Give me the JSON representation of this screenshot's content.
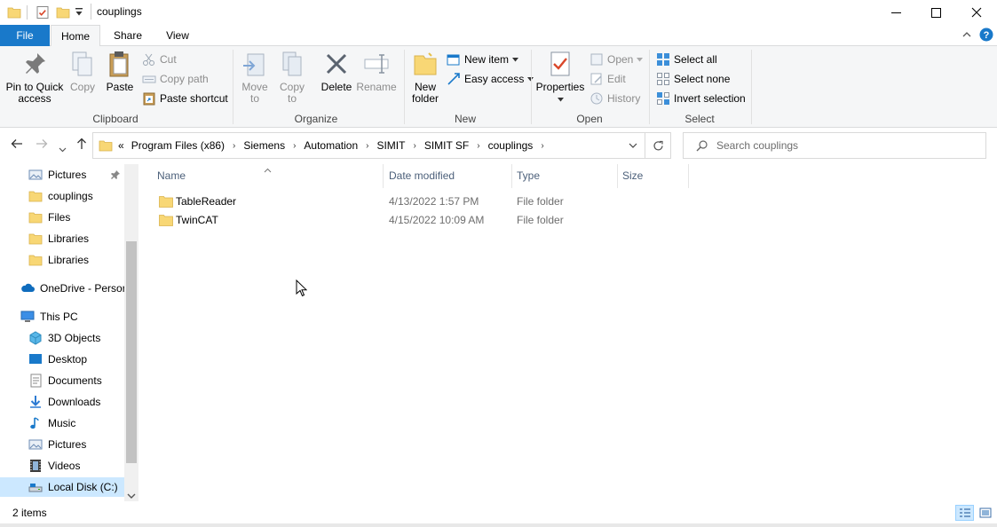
{
  "window": {
    "title": "couplings",
    "controls": {
      "minimize": "—",
      "maximize": "☐",
      "close": "✕"
    }
  },
  "ribbon_tabs": [
    "File",
    "Home",
    "Share",
    "View"
  ],
  "ribbon": {
    "clipboard": {
      "label": "Clipboard",
      "pin_line1": "Pin to Quick",
      "pin_line2": "access",
      "copy": "Copy",
      "paste": "Paste",
      "cut": "Cut",
      "copy_path": "Copy path",
      "paste_shortcut": "Paste shortcut"
    },
    "organize": {
      "label": "Organize",
      "move_to_line1": "Move",
      "move_to_line2": "to",
      "copy_to_line1": "Copy",
      "copy_to_line2": "to",
      "delete": "Delete",
      "rename": "Rename"
    },
    "new": {
      "label": "New",
      "new_folder_line1": "New",
      "new_folder_line2": "folder",
      "new_item": "New item",
      "easy_access": "Easy access"
    },
    "open": {
      "label": "Open",
      "properties": "Properties",
      "open": "Open",
      "edit": "Edit",
      "history": "History"
    },
    "select": {
      "label": "Select",
      "select_all": "Select all",
      "select_none": "Select none",
      "invert_selection": "Invert selection"
    }
  },
  "address": {
    "overflow": "«",
    "crumbs": [
      "Program Files (x86)",
      "Siemens",
      "Automation",
      "SIMIT",
      "SIMIT SF",
      "couplings"
    ]
  },
  "search": {
    "placeholder": "Search couplings"
  },
  "nav_pane": {
    "quick_access": [
      "Pictures",
      "couplings",
      "Files",
      "Libraries",
      "Libraries"
    ],
    "onedrive": "OneDrive - Persor",
    "this_pc": "This PC",
    "this_pc_items": [
      "3D Objects",
      "Desktop",
      "Documents",
      "Downloads",
      "Music",
      "Pictures",
      "Videos",
      "Local Disk (C:)"
    ]
  },
  "columns": {
    "name": "Name",
    "date": "Date modified",
    "type": "Type",
    "size": "Size"
  },
  "files": [
    {
      "name": "TableReader",
      "date": "4/13/2022 1:57 PM",
      "type": "File folder",
      "size": ""
    },
    {
      "name": "TwinCAT",
      "date": "4/15/2022 10:09 AM",
      "type": "File folder",
      "size": ""
    }
  ],
  "status": {
    "item_count": "2 items"
  },
  "colors": {
    "accent": "#1979ca",
    "folder": "#f8d775",
    "selection": "#cce8ff"
  }
}
